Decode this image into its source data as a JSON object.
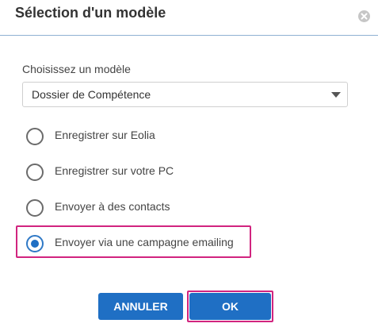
{
  "dialog": {
    "title": "Sélection d'un modèle",
    "close_icon": "close-circle-icon"
  },
  "model_select": {
    "label": "Choisissez un modèle",
    "selected": "Dossier de Compétence",
    "arrow_icon": "caret-down-icon"
  },
  "options": [
    {
      "label": "Enregistrer sur Eolia",
      "checked": false
    },
    {
      "label": "Enregistrer sur votre PC",
      "checked": false
    },
    {
      "label": "Envoyer à des contacts",
      "checked": false
    },
    {
      "label": "Envoyer via une campagne emailing",
      "checked": true
    }
  ],
  "buttons": {
    "cancel": "ANNULER",
    "ok": "OK"
  },
  "colors": {
    "primary": "#1f6fc4",
    "highlight": "#d1247f",
    "header_border": "#8fb1d3"
  }
}
